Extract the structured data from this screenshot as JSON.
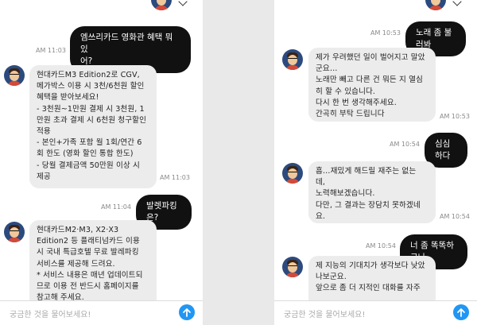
{
  "left": {
    "messages": [
      {
        "role": "user",
        "text": "엠쓰리카드 영화관 혜택 뭐 있\n어?",
        "time": "AM 11:03"
      },
      {
        "role": "bot",
        "text": "현대카드M3 Edition2로 CGV,\n메가박스 이용 시 3천/6천원 할인\n혜택을 받아보세요!\n- 3천원~1만원 결제 시 3천원, 1\n만원 초과 결제 시 6천원 청구할인\n적용\n- 본인+가족 포함 월 1회/연간 6\n회 한도 (영화 할인 통합 한도)\n- 당월 결제금액 50만원 이상 시\n제공",
        "time": "AM 11:03"
      },
      {
        "role": "user",
        "text": "발렛파킹은?",
        "time": "AM 11:04"
      },
      {
        "role": "bot",
        "text": "현대카드M2·M3, X2·X3\nEdition2 등 플래티넘카드 이용\n시 국내 특급호텔 무료 발레파킹\n서비스를 제공해 드려요.\n* 서비스 내용은 매년 업데이트되\n므로 이용 전 반드시 홈페이지를\n참고해 주세요."
      }
    ],
    "input_placeholder": "궁금한 것을 물어보세요!"
  },
  "right": {
    "messages": [
      {
        "role": "user",
        "text": "노래 좀 불러봐",
        "time": "AM 10:53"
      },
      {
        "role": "bot",
        "text": "제가 우려했던 일이 벌어지고 말았\n군요…\n노래만 빼고 다른 건 뭐든 지 열심\n히 할 수 있습니다.\n다시 한 번 생각해주세요.\n간곡히 부탁 드립니다",
        "time": "AM 10:53"
      },
      {
        "role": "user",
        "text": "심심하다",
        "time": "AM 10:54"
      },
      {
        "role": "bot",
        "text": "흠…재밌게 해드릴 재주는 없는\n데,\n노력해보겠습니다.\n다만, 그 결과는 장담치 못하겠네\n요.",
        "time": "AM 10:54"
      },
      {
        "role": "user",
        "text": "너 좀 똑똑하구나",
        "time": "AM 10:54"
      },
      {
        "role": "bot",
        "text": "제 지능의 기대치가 생각보다 낮았\n나보군요.\n앞으로 좀 더 지적인 대화를 자주"
      }
    ],
    "input_placeholder": "궁금한 것을 물어보세요!"
  },
  "icons": {
    "send": "send-arrow-icon",
    "menu": "chevron-down-icon",
    "avatar": "bot-avatar-icon"
  },
  "colors": {
    "user_bubble": "#111111",
    "bot_bubble": "#ececec",
    "send_button": "#2196f3",
    "background": "#e9e9e9"
  }
}
